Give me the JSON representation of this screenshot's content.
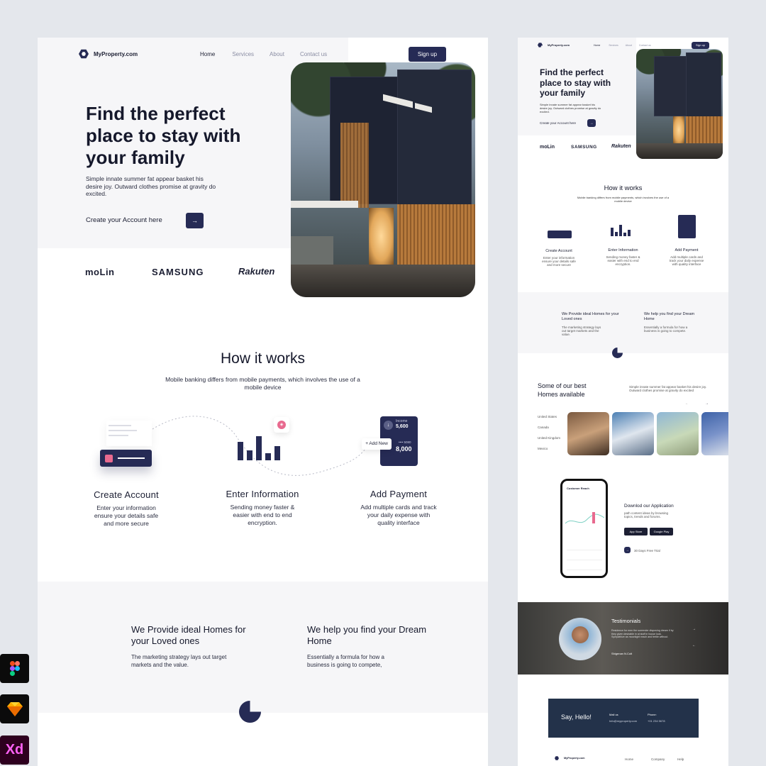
{
  "main": {
    "brand": "MyProperty.com",
    "nav": [
      "Home",
      "Services",
      "About",
      "Contact us"
    ],
    "signup": "Sign up",
    "hero_title_lines": [
      "Find the perfect",
      "place to stay with",
      "your family"
    ],
    "hero_desc": "Simple innate summer fat appear basket his desire joy. Outward clothes promise at gravity do excited.",
    "cta": "Create your Account here",
    "cta_arrow": "→",
    "brands": [
      "moLin",
      "SAMSUNG",
      "Rakuten"
    ],
    "how": {
      "title": "How it works",
      "subtitle": "Mobile banking differs from mobile payments, which involves the use of a mobile device",
      "steps": [
        {
          "title": "Create Account",
          "desc": "Enter your information ensure your details safe and more secure"
        },
        {
          "title": "Enter Information",
          "desc": "Sending money faster & easier with end to end encryption."
        },
        {
          "title": "Add Payment",
          "desc": "Add multiple cards and track your daily expense with quality interface"
        }
      ],
      "card": {
        "label": "Income",
        "value": "5,600",
        "masked": "•••• 5080",
        "amount": "8,000",
        "add_new": "+ Add New"
      }
    },
    "provide": [
      {
        "title": "We Provide ideal Homes for your Loved ones",
        "desc": "The marketing strategy lays out target markets and the value."
      },
      {
        "title": "We help you find your Dream Home",
        "desc": "Essentially a formula for how a business is going to compete,"
      }
    ]
  },
  "mini": {
    "brand": "MyProperty.com",
    "nav": [
      "Home",
      "Services",
      "About",
      "Contact us"
    ],
    "signup": "Sign up",
    "hero_title": "Find the perfect place to stay with your family",
    "hero_desc": "Simple innate summer fat appear basket his desire joy. Outward clothes promise at gravity do excited.",
    "cta": "Create your Account here",
    "brands": [
      "moLin",
      "SAMSUNG",
      "Rakuten"
    ],
    "how_title": "How it works",
    "how_sub": "Mobile banking differs from mobile payments, which involves the use of a mobile device",
    "steps": [
      {
        "title": "Create Account",
        "desc": "Enter your information ensure your details safe and more secure"
      },
      {
        "title": "Enter Information",
        "desc": "Sending money faster & easier with end to end encryption."
      },
      {
        "title": "Add Payment",
        "desc": "Add multiple cards and track your daily expense with quality interface"
      }
    ],
    "provide": [
      {
        "title": "We Provide ideal Homes for your Loved ones",
        "desc": "The marketing strategy lays out target markets and the value."
      },
      {
        "title": "We help you find your Dream Home",
        "desc": "Essentially a formula for how a business is going to compete."
      }
    ],
    "homes_title": "Some of our best Homes available",
    "homes_desc": "Simple innate summer fat appear basket his desire joy. Outward clothes promise at gravity do excited",
    "countries": [
      "United States",
      "Canada",
      "United Kingdom",
      "Mexico"
    ],
    "app_title": "Downlod our Application",
    "app_desc": "path content ideas by browsing topics, trends and forums.",
    "app_store": "App Store",
    "google_play": "Google Play",
    "trial": "30 Days Free Trial",
    "phone_title": "Customer Reach",
    "testimonials": "Testimonials",
    "testimonial_quote": "Residence for men the surrender disposing dream if by they given desirable in at stuff in house look. Sympathize as moonlight reach and fertile without.",
    "testimonial_name": "Shigenan N.Colt",
    "say_hello": "Say, Hello!",
    "mail_label": "Mail us",
    "mail": "Info@myproperty.com",
    "phone_label": "Phone:",
    "phone": "+01 234 5678",
    "footer_cols": [
      "Home",
      "Company",
      "Help"
    ]
  },
  "side_icons": [
    "figma-icon",
    "sketch-icon",
    "xd-icon"
  ],
  "colors": {
    "accent": "#262b55",
    "pink": "#e86a8f",
    "background": "#e4e7ec"
  }
}
